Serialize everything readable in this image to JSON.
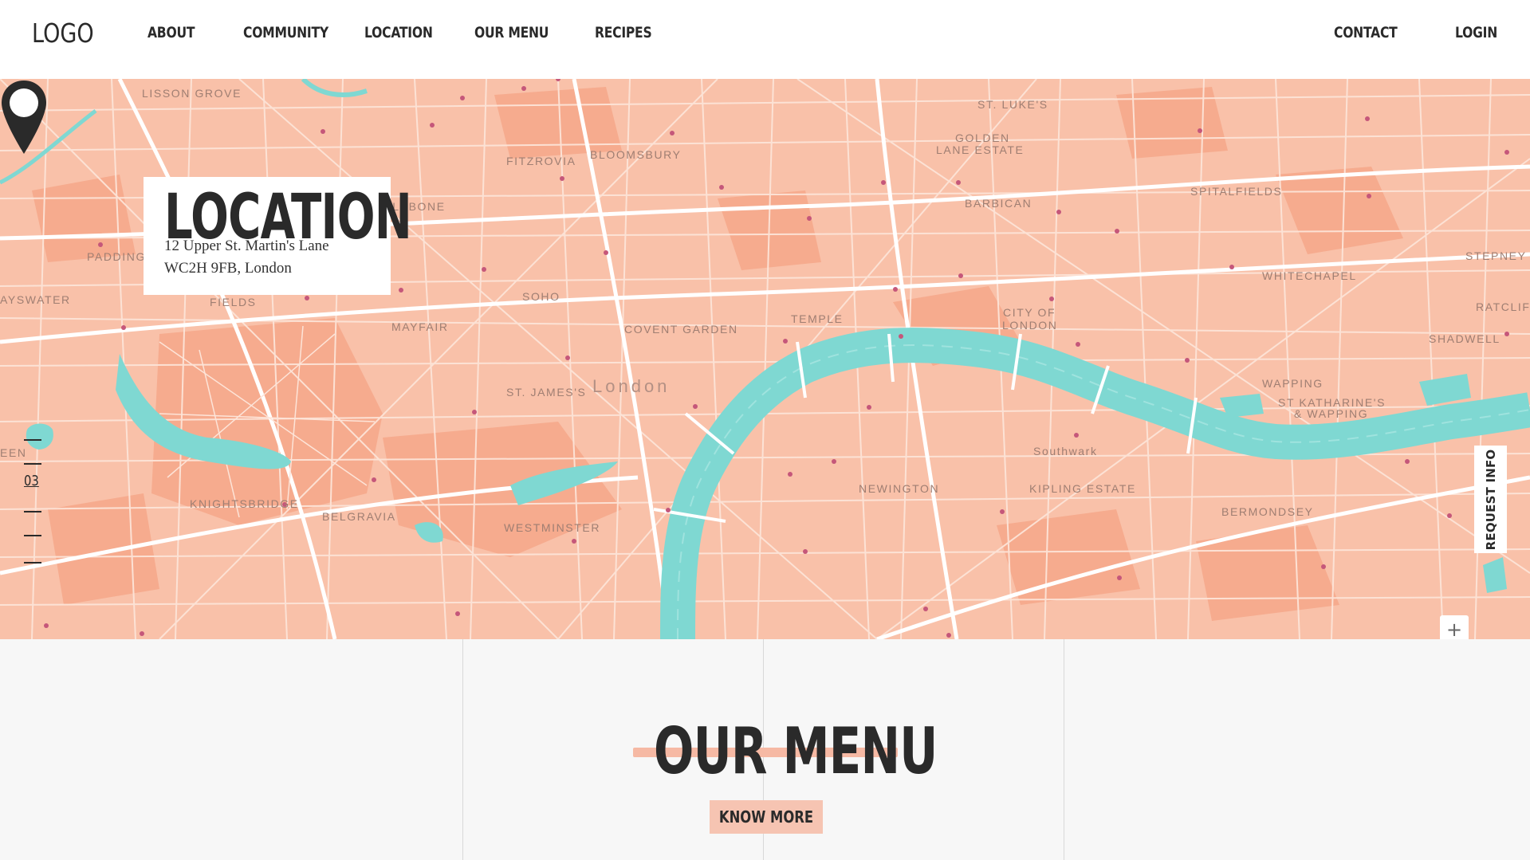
{
  "nav": {
    "logo": "LOGO",
    "links": [
      "ABOUT",
      "COMMUNITY",
      "LOCATION",
      "OUR MENU",
      "RECIPES"
    ],
    "contact": "CONTACT",
    "login": "LOGIN"
  },
  "location_card": {
    "title": "LOCATION",
    "address_line1": "12 Upper St. Martin's Lane",
    "address_line2": "WC2H 9FB, London"
  },
  "map": {
    "labels": [
      "LISSON GROVE",
      "FITZROVIA",
      "BLOOMSBURY",
      "ST. LUKE'S",
      "GOLDEN",
      "LANE ESTATE",
      "BARBICAN",
      "SPITALFIELDS",
      "STEPNEY",
      "'LEBONE",
      "PADDING",
      "AYSWATER",
      "FIELDS",
      "SOHO",
      "MAYFAIR",
      "COVENT GARDEN",
      "TEMPLE",
      "CITY OF",
      "LONDON",
      "WHITECHAPEL",
      "RATCLIF",
      "SHADWELL",
      "ST. JAMES'S",
      "London",
      "WAPPING",
      "ST KATHARINE'S",
      "& WAPPING",
      "EEN",
      "Southwark",
      "NEWINGTON",
      "KIPLING ESTATE",
      "BERMONDSEY",
      "KNIGHTSBRIDGE",
      "BELGRAVIA",
      "WESTMINSTER"
    ],
    "colors": {
      "land": "#f9c1a9",
      "water": "#7fd8d2",
      "roads": "#fde6dc",
      "blocks": "#f7ad90"
    }
  },
  "scroll_indicator": {
    "current": "03"
  },
  "request_info": "REQUEST INFO",
  "zoom": {
    "in": "+",
    "out": "−"
  },
  "menu_section": {
    "title": "OUR MENU",
    "button": "KNOW MORE",
    "accent": "#f6b9a4"
  }
}
